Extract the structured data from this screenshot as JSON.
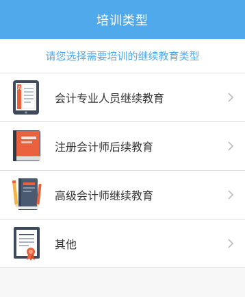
{
  "header": {
    "title": "培训类型"
  },
  "prompt": "请您选择需要培训的继续教育类型",
  "items": [
    {
      "label": "会计专业人员继续教育",
      "icon": "tablet-document-icon"
    },
    {
      "label": "注册会计师后续教育",
      "icon": "book-icon"
    },
    {
      "label": "高级会计师继续教育",
      "icon": "notebook-pencil-icon"
    },
    {
      "label": "其他",
      "icon": "certificate-icon"
    }
  ],
  "colors": {
    "accent": "#4fa9ea",
    "text": "#333333",
    "chevron": "#bbbbbb"
  }
}
